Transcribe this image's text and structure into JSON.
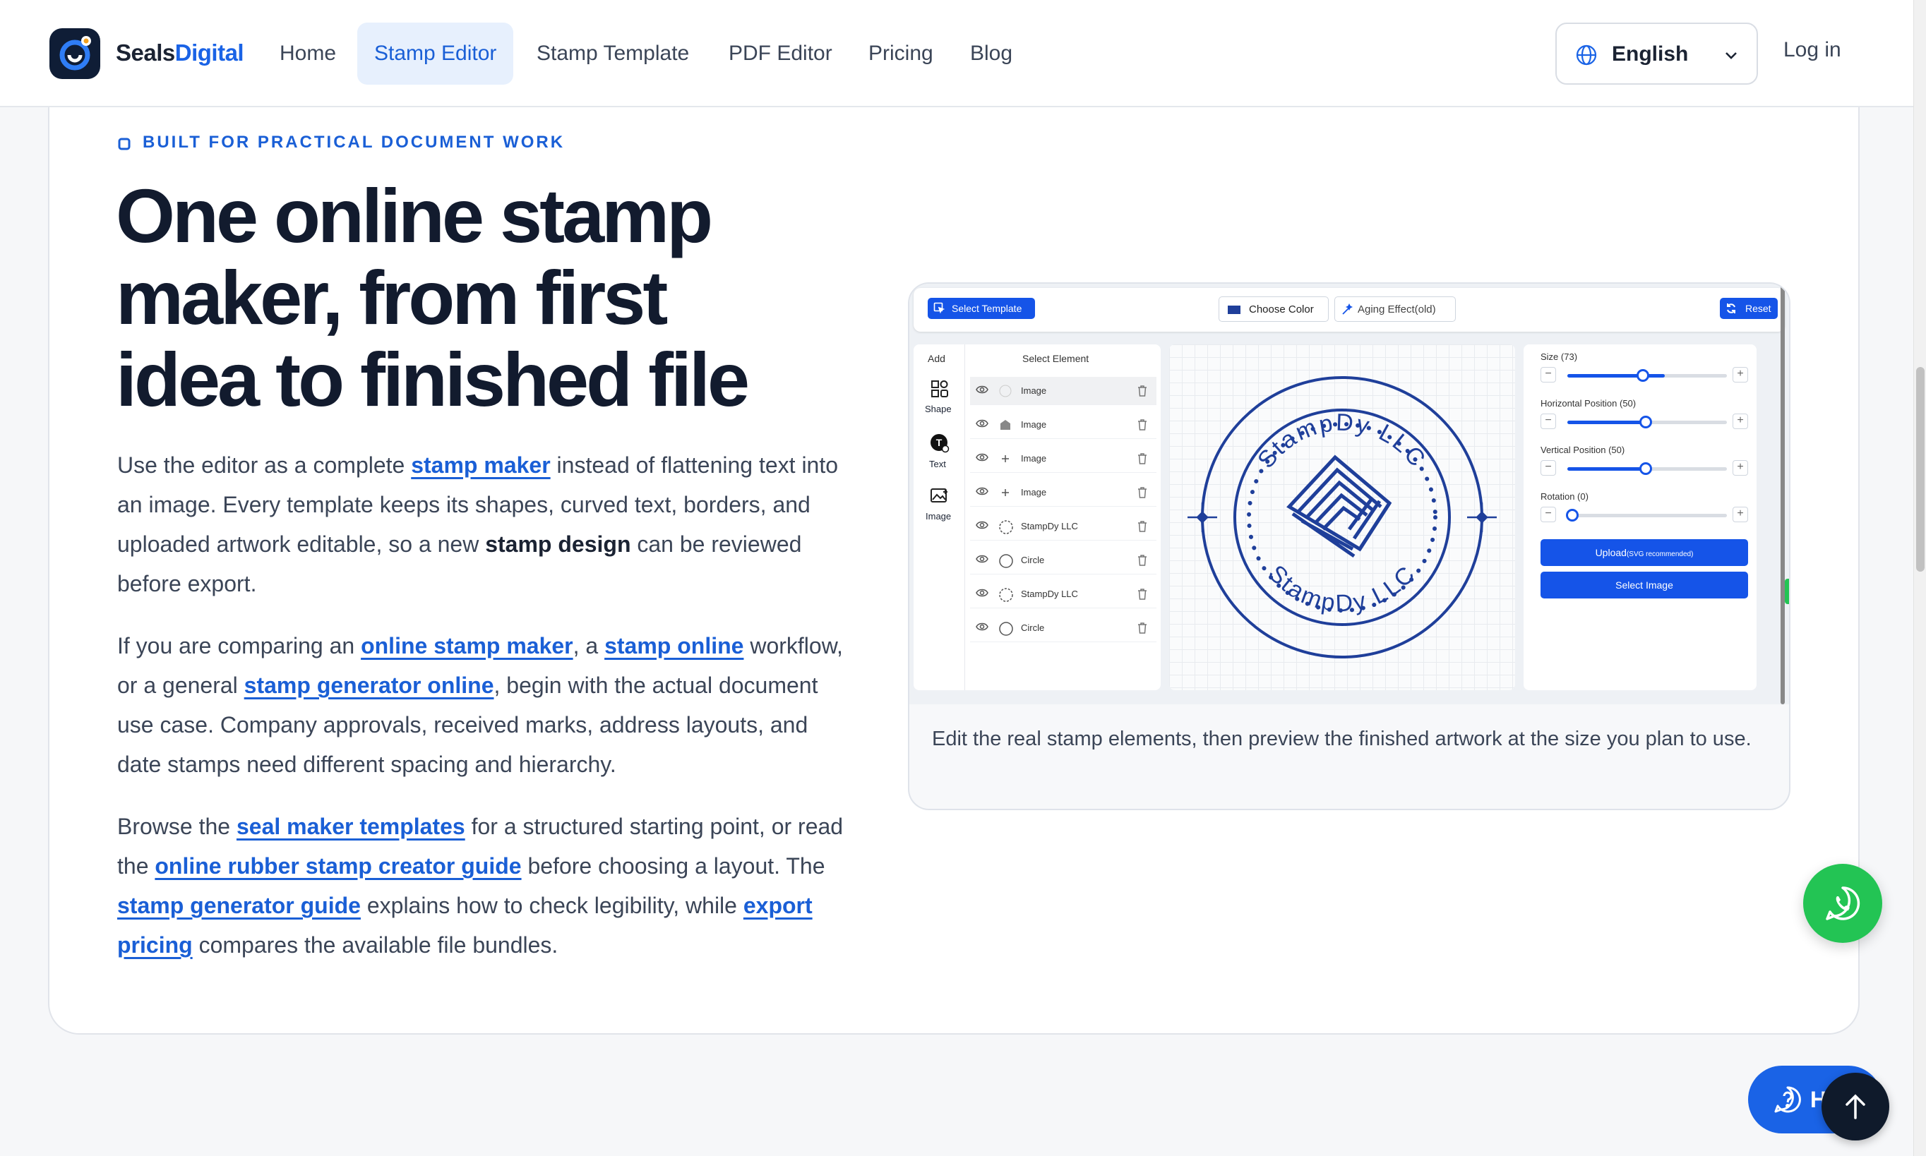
{
  "header": {
    "brand_part1": "Seals",
    "brand_part2": "Digital",
    "nav": [
      {
        "label": "Home",
        "active": false
      },
      {
        "label": "Stamp Editor",
        "active": true
      },
      {
        "label": "Stamp Template",
        "active": false
      },
      {
        "label": "PDF Editor",
        "active": false
      },
      {
        "label": "Pricing",
        "active": false
      },
      {
        "label": "Blog",
        "active": false
      }
    ],
    "language": "English",
    "login": "Log in"
  },
  "hero": {
    "eyebrow": "BUILT FOR PRACTICAL DOCUMENT WORK",
    "title_line1": "One online stamp",
    "title_line2": "maker, from first",
    "title_line3": "idea to finished file",
    "p1": {
      "t1": "Use the editor as a complete ",
      "link1": "stamp maker",
      "t2": " instead of flattening text into an image. Every template keeps its shapes, curved text, borders, and uploaded artwork editable, so a new ",
      "bold1": "stamp design",
      "t3": " can be reviewed before export."
    },
    "p2": {
      "t1": "If you are comparing an ",
      "link1": "online stamp maker",
      "t2": ", a ",
      "link2": "stamp online",
      "t3": " workflow, or a general ",
      "link3": "stamp generator online",
      "t4": ", begin with the actual document use case. Company approvals, received marks, address layouts, and date stamps need different spacing and hierarchy."
    },
    "p3": {
      "t1": "Browse the ",
      "link1": "seal maker templates",
      "t2": " for a structured starting point, or read the ",
      "link2": "online rubber stamp creator guide",
      "t3": " before choosing a layout. The ",
      "link3": "stamp generator guide",
      "t4": " explains how to check legibility, while ",
      "link4": "export pricing",
      "t5": " compares the available file bundles."
    }
  },
  "preview": {
    "caption": "Edit the real stamp elements, then preview the finished artwork at the size you plan to use.",
    "toolbar": {
      "select_template": "Select Template",
      "choose_color": "Choose Color",
      "aging": "Aging Effect(old)",
      "reset": "Reset"
    },
    "sidebar": {
      "add": "Add",
      "shape": "Shape",
      "text": "Text",
      "image": "Image"
    },
    "elements_title": "Select Element",
    "elements": [
      "Image",
      "Image",
      "Image",
      "Image",
      "StampDy LLC",
      "Circle",
      "StampDy LLC",
      "Circle"
    ],
    "controls": {
      "size_label": "Size (73)",
      "size": 73,
      "hpos_label": "Horizontal Position (50)",
      "hpos": 50,
      "vpos_label": "Vertical Position (50)",
      "vpos": 50,
      "rotation_label": "Rotation (0)",
      "rotation": 0,
      "upload": "Upload",
      "upload_note": "(SVG recommended)",
      "select_image": "Select Image"
    },
    "stamp": {
      "top_text": "StampDy LLC",
      "bottom_text": "StampDy LLC",
      "color": "#1f3f9a"
    }
  },
  "floating": {
    "help": "H"
  },
  "colors": {
    "accent": "#1a63e6",
    "whatsapp": "#23c454",
    "dark": "#0f1a2b"
  }
}
